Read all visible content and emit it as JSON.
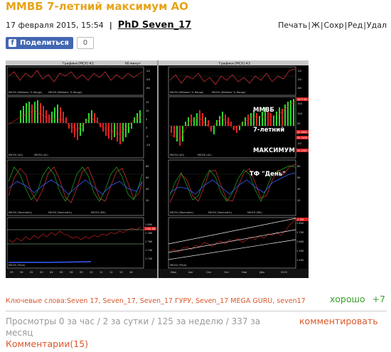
{
  "post": {
    "title": "ММВБ 7-летний максимум АО",
    "date": "17 февраля 2015, 15:54",
    "separator": "|",
    "author": "PhD Seven_17"
  },
  "actions": [
    {
      "label": "Печать"
    },
    {
      "label": "Ж"
    },
    {
      "label": "Сохр"
    },
    {
      "label": "Ред"
    },
    {
      "label": "Удал"
    }
  ],
  "share": {
    "fb_label": "Поделиться",
    "fb_icon": "f",
    "count": "0"
  },
  "chart_image": {
    "left_title": "Графики [МСХ] #2",
    "left_subtitle": "60 минут",
    "right_title": "Графики [МСХ] #3",
    "annotations": {
      "line1": "ММВБ",
      "line2": "7-летний",
      "line3": "МАКСИМУМ",
      "line4": "ТФ \"День\""
    },
    "labels": {
      "lw1": "MICEX (Williams' % Range)",
      "lw1b": "MICEX (Williams' % Range)",
      "lw2": "MICEX (AO)",
      "lw2b": "MICEX (AC)",
      "lw3": "MICEX (Stochastic)",
      "lw3b": "MICEX (Stochastic)",
      "lw3c": "MICEX (RSI)",
      "lw4": "MICEX (Price)",
      "rw1": "MICEX (Williams' % Range)",
      "rw1b": "MICEX (Williams' % Range)",
      "rw2": "MICEX (AO)",
      "rw2b": "MICEX (AC)",
      "rw3": "MICEX (Stochastic)",
      "rw3b": "MICEX (Stochastic)",
      "rw3c": "MICEX (RSI)",
      "rw4": "MICEX (Price)"
    },
    "left_axis": {
      "p1": [
        "-20",
        "-50",
        "-80"
      ],
      "p2": [
        "15",
        "10",
        "5",
        "0",
        "-5",
        "-10"
      ],
      "p3": [
        "80",
        "60",
        "40",
        "20"
      ],
      "p4": [
        "1 800",
        "1 780",
        "1 760",
        "1 740",
        "1 720"
      ]
    },
    "right_axis": {
      "p1": [
        "-20",
        "-50",
        "-80"
      ],
      "p2": [
        "150",
        "100",
        "50",
        "0",
        "-50"
      ],
      "p3": [
        "80",
        "60",
        "40",
        "20"
      ],
      "p4": [
        "1 800",
        "1 700",
        "1 600",
        "1 500",
        "1 400"
      ]
    },
    "left_time": [
      "29",
      "30",
      "02",
      "03",
      "04",
      "05",
      "06",
      "09",
      "10",
      "11",
      "12",
      "13",
      "16"
    ],
    "right_time": [
      "Июл",
      "Авг",
      "Сен",
      "Окт",
      "Ноя",
      "Дек",
      "2015"
    ],
    "tags": {
      "t1": "1781.96",
      "t2": "1673.81",
      "t3": "52.3801",
      "t4": "95.7639",
      "t5": "53.2467",
      "t6": "1 781"
    }
  },
  "keywords": {
    "label": "Ключевые слова:",
    "list": "Seven 17, Seven_17, Seven_17 ГУРУ, Seven_17 MEGA GURU, seven17"
  },
  "rating": {
    "label": "хорошо",
    "value": "+7"
  },
  "stats": {
    "views": "Просмотры 0 за час / 2 за сутки / 125 за неделю / 337 за месяц",
    "comment_action": "комментировать",
    "comments": "Комментарии(15)"
  },
  "colors": {
    "title": "#e8a317",
    "link": "#d9582b",
    "positive": "#3aa12c",
    "facebook": "#4267b2",
    "chart_bg": "#000000"
  }
}
